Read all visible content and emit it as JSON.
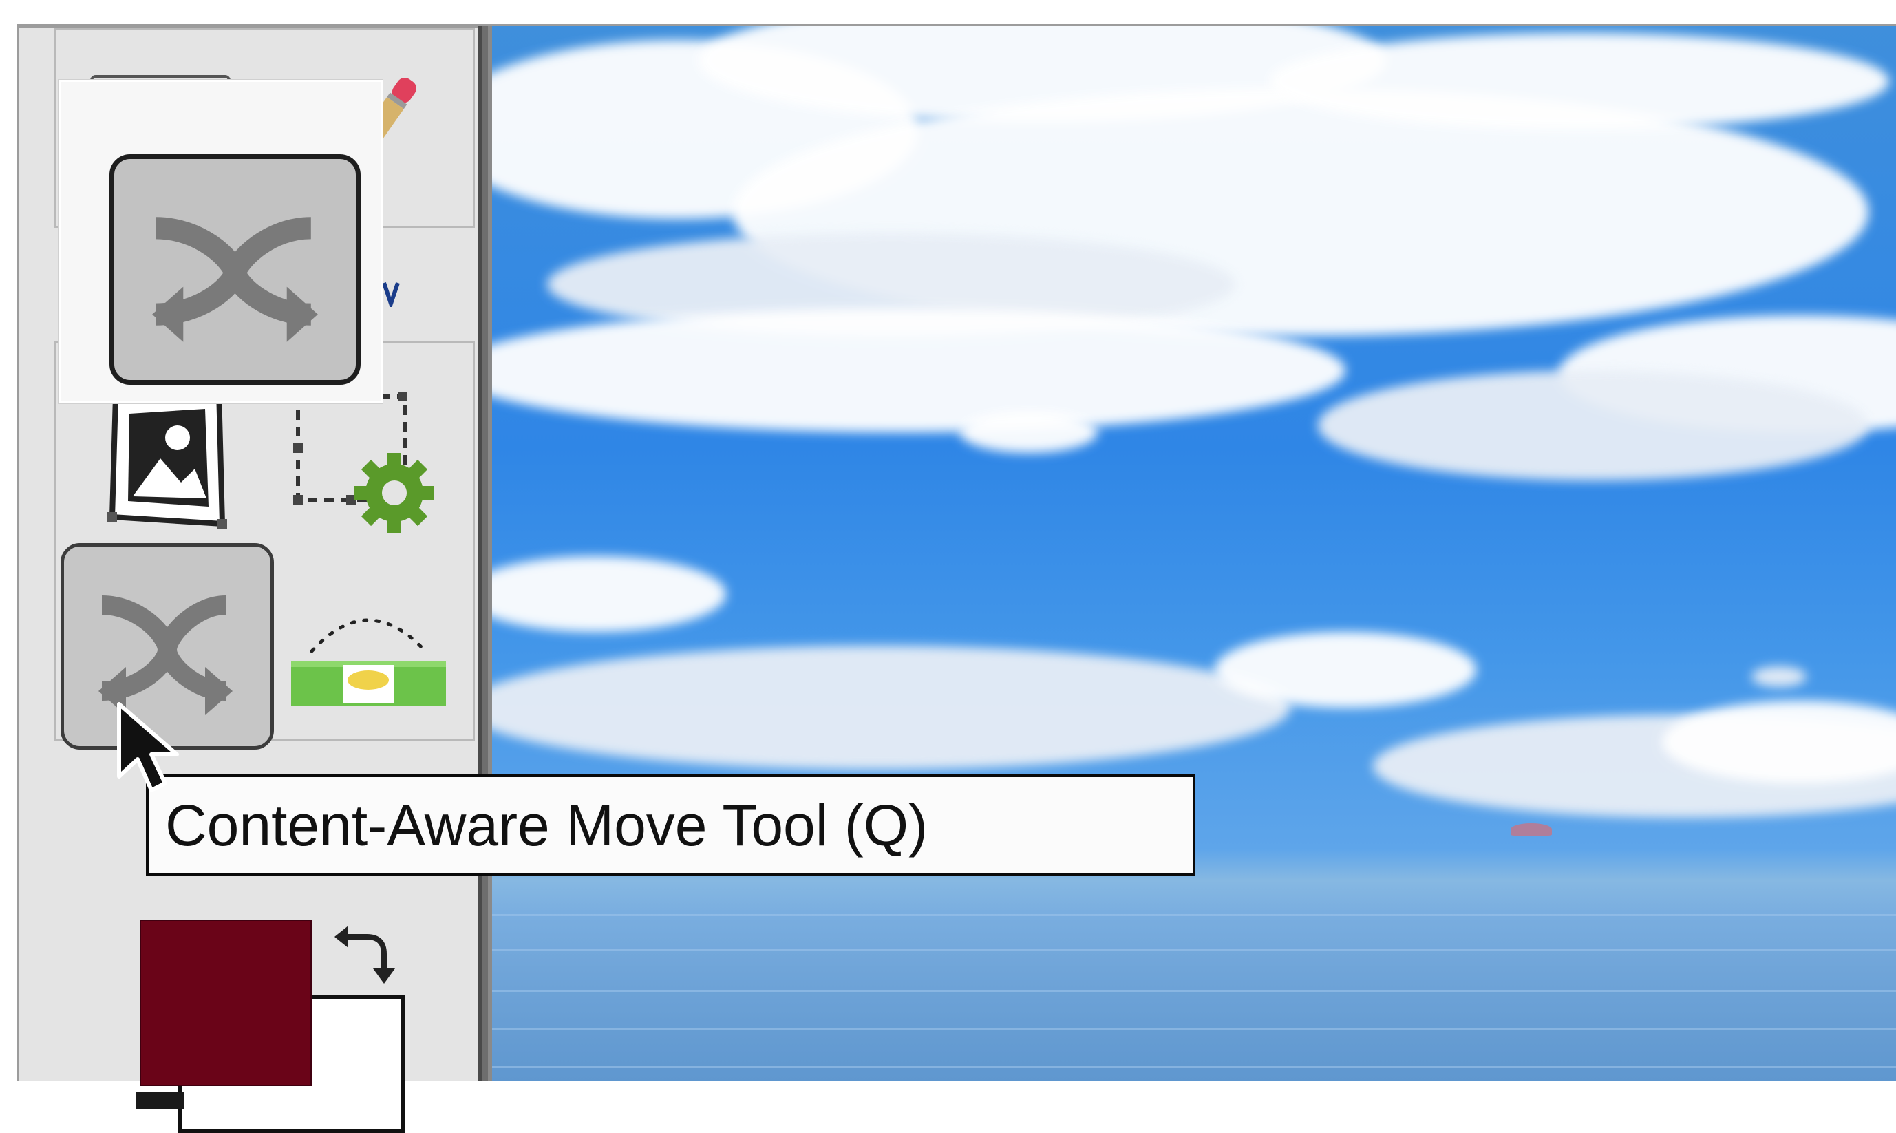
{
  "tooltip": {
    "text": "Content-Aware Move Tool (Q)"
  },
  "tools": [
    {
      "name": "pencil-tool",
      "icon": "pencil-icon"
    },
    {
      "name": "frame-tool",
      "icon": "frame-image-icon"
    },
    {
      "name": "artboard-tool",
      "icon": "artboard-gear-icon"
    },
    {
      "name": "content-aware-move-tool",
      "icon": "crossed-arrows-icon",
      "selected": true
    },
    {
      "name": "level-tool",
      "icon": "level-icon"
    }
  ],
  "colors": {
    "foreground": "#6a0418",
    "background": "#ffffff",
    "sky": "#2f86e6",
    "gear_green": "#5a9a2a",
    "level_green": "#6cc34a"
  }
}
